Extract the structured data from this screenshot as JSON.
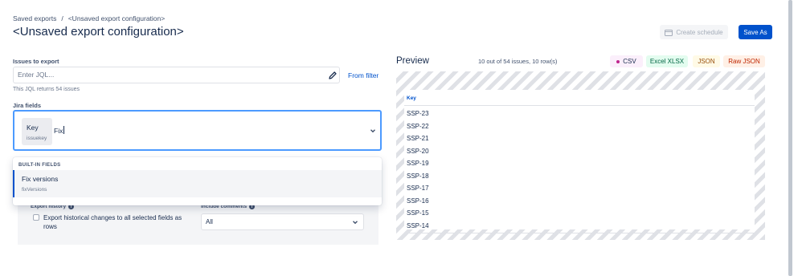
{
  "breadcrumb": {
    "saved_exports": "Saved exports",
    "separator": "/",
    "current": "<Unsaved export configuration>"
  },
  "page_title": "<Unsaved export configuration>",
  "header_actions": {
    "create_schedule": "Create schedule",
    "save_as": "Save As"
  },
  "issues": {
    "label": "Issues to export",
    "jql_placeholder": "Enter JQL...",
    "jql_value": "",
    "from_filter": "From filter",
    "hint": "This JQL returns 54 issues"
  },
  "jira_fields": {
    "label": "Jira fields",
    "selected_chip": {
      "title": "Key",
      "sub": "issuekey"
    },
    "typed_text": "Fix",
    "dropdown": {
      "group": "BUILT-IN FIELDS",
      "options": [
        {
          "title": "Fix versions",
          "sub": "fixVersions"
        }
      ]
    }
  },
  "options": {
    "export_history_label": "Export history",
    "export_history_checkbox": "Export historical changes to all selected fields as rows",
    "include_comments_label": "Include comments",
    "include_comments_value": "All"
  },
  "preview": {
    "title": "Preview",
    "count": "10 out of 54 issues, 10 row(s)",
    "formats": [
      "CSV",
      "Excel XLSX",
      "JSON",
      "Raw JSON"
    ],
    "selected_format": "CSV",
    "column_header": "Key",
    "rows": [
      "SSP-23",
      "SSP-22",
      "SSP-21",
      "SSP-20",
      "SSP-19",
      "SSP-18",
      "SSP-17",
      "SSP-16",
      "SSP-15",
      "SSP-14"
    ]
  },
  "colors": {
    "primary": "#0052cc",
    "focus_border": "#4c9aff",
    "csv_dot": "#c0258e"
  },
  "icons": [
    "pencil-icon",
    "calendar-icon",
    "chevron-down-icon",
    "info-icon"
  ]
}
